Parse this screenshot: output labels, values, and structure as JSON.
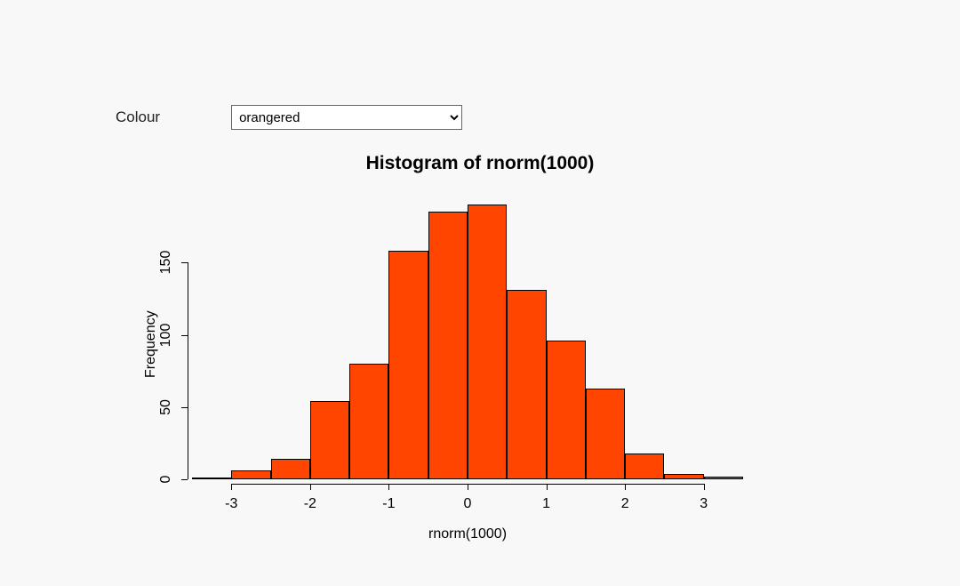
{
  "control": {
    "label": "Colour",
    "selected": "orangered",
    "options": [
      "orangered"
    ]
  },
  "chart_data": {
    "type": "bar",
    "title": "Histogram of rnorm(1000)",
    "xlabel": "rnorm(1000)",
    "ylabel": "Frequency",
    "fill": "#ff4500",
    "xlim": [
      -3.5,
      3.5
    ],
    "ylim": [
      0,
      200
    ],
    "binwidth": 0.5,
    "x_ticks": [
      -3,
      -2,
      -1,
      0,
      1,
      2,
      3
    ],
    "y_ticks": [
      0,
      50,
      100,
      150
    ],
    "categories": [
      -3.25,
      -2.75,
      -2.25,
      -1.75,
      -1.25,
      -0.75,
      -0.25,
      0.25,
      0.75,
      1.25,
      1.75,
      2.25,
      2.75,
      3.25
    ],
    "values": [
      1,
      6,
      14,
      54,
      80,
      158,
      185,
      190,
      131,
      96,
      63,
      18,
      4,
      2
    ]
  }
}
